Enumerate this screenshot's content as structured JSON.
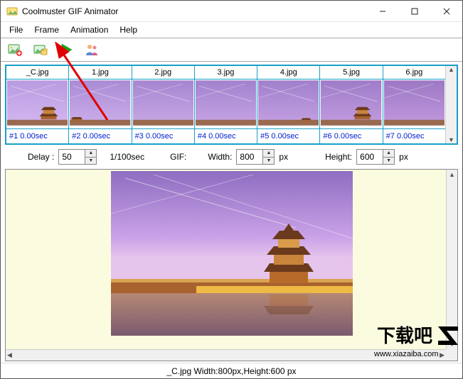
{
  "app": {
    "title": "Coolmuster GIF Animator"
  },
  "menu": {
    "file": "File",
    "frame": "Frame",
    "animation": "Animation",
    "help": "Help"
  },
  "toolbar": {
    "add_image": "add-image",
    "add_folder": "add-folder",
    "play": "play",
    "users": "users"
  },
  "frames": [
    {
      "name": "_C.jpg",
      "meta": "#1  0.00sec",
      "grad_top": "#b89be0",
      "grad_bot": "#d4b6f0",
      "fg": "big"
    },
    {
      "name": "1.jpg",
      "meta": "#2  0.00sec",
      "grad_top": "#a98bd5",
      "grad_bot": "#cdaeea",
      "fg": "small"
    },
    {
      "name": "2.jpg",
      "meta": "#3  0.00sec",
      "grad_top": "#a585d0",
      "grad_bot": "#c9a8e6",
      "fg": "none"
    },
    {
      "name": "3.jpg",
      "meta": "#4  0.00sec",
      "grad_top": "#a282ce",
      "grad_bot": "#c6a4e4",
      "fg": "none"
    },
    {
      "name": "4.jpg",
      "meta": "#5  0.00sec",
      "grad_top": "#a080cc",
      "grad_bot": "#c4a0e2",
      "fg": "tiny"
    },
    {
      "name": "5.jpg",
      "meta": "#6  0.00sec",
      "grad_top": "#9e7cc8",
      "grad_bot": "#c29ce0",
      "fg": "big"
    },
    {
      "name": "6.jpg",
      "meta": "#7  0.00sec",
      "grad_top": "#9c78c4",
      "grad_bot": "#c098de",
      "fg": "none"
    }
  ],
  "controls": {
    "delay_label": "Delay :",
    "delay_value": "50",
    "delay_unit": "1/100sec",
    "gif_label": "GIF:",
    "width_label": "Width:",
    "width_value": "800",
    "height_label": "Height:",
    "height_value": "600",
    "px_unit": "px"
  },
  "status": {
    "text": "_C.jpg Width:800px,Height:600 px"
  },
  "watermark": {
    "line1": "下载吧",
    "line2": "www.xiazaiba.com"
  }
}
